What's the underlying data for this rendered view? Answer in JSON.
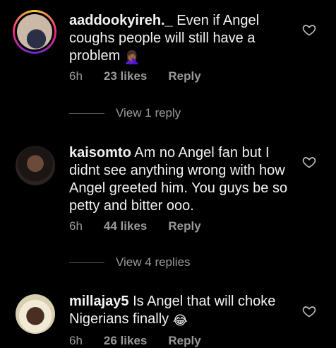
{
  "comments": [
    {
      "username": "aaddookyireh._",
      "text": "Even if Angel coughs people will still have a problem",
      "emoji": "🤦🏾‍♀️",
      "time": "6h",
      "likes": "23 likes",
      "reply": "Reply",
      "view_replies": "View 1 reply"
    },
    {
      "username": "kaisomto",
      "text": "Am no Angel fan but I didnt see anything wrong with how Angel greeted him. You guys be so petty and bitter ooo.",
      "time": "6h",
      "likes": "44 likes",
      "reply": "Reply",
      "view_replies": "View 4 replies"
    },
    {
      "username": "millajay5",
      "text": "Is Angel that will choke Nigerians finally",
      "emoji": "😂",
      "time": "6h",
      "likes": "26 likes",
      "reply": "Reply"
    }
  ]
}
